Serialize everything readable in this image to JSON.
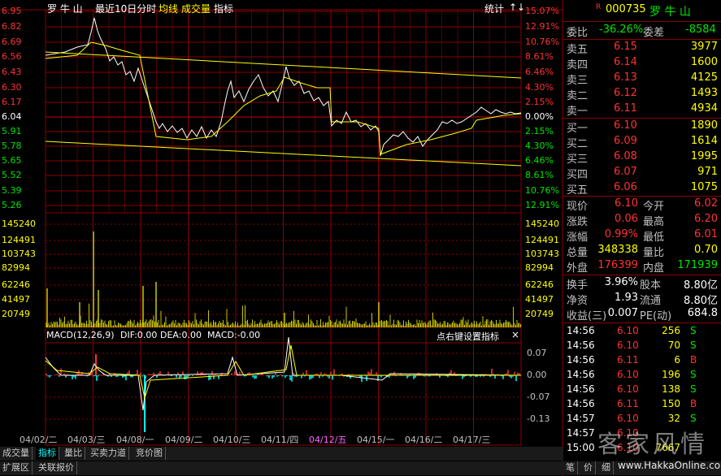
{
  "header": {
    "stock_name": "罗 牛 山",
    "period": "最近10日分时",
    "avg_label": "均线",
    "vol_label": "成交量",
    "indicator_label": "指标",
    "stats_label": "统计",
    "arrow_up": "↑",
    "arrow_down": "↓"
  },
  "price_axis": {
    "left": [
      "6.95",
      "6.82",
      "6.69",
      "6.56",
      "6.43",
      "6.30",
      "6.17",
      "6.04",
      "5.91",
      "5.78",
      "5.65",
      "5.52",
      "5.39",
      "5.26"
    ],
    "right": [
      "15.07%",
      "12.91%",
      "10.76%",
      "8.61%",
      "6.46%",
      "4.30%",
      "2.15%",
      "0.00%",
      "2.15%",
      "4.30%",
      "6.46%",
      "8.61%",
      "10.76%",
      "12.91%"
    ]
  },
  "volume_axis": [
    "145240",
    "124491",
    "103743",
    "82994",
    "62246",
    "41497",
    "20749"
  ],
  "macd": {
    "title": "MACD(12,26,9)",
    "dif": "DIF:0.00",
    "dea": "DEA:0.00",
    "macd": "MACD:-0.00",
    "right_hint": "点右键设置指标",
    "close_glyph": "×",
    "ticks": [
      "0.07",
      "0.00",
      "-0.07",
      "-0.13"
    ]
  },
  "x_axis": [
    "04/02/二",
    "04/03/三",
    "04/08/一",
    "04/09/二",
    "04/10/三",
    "04/11/四",
    "04/12/五",
    "04/15/一",
    "04/16/二",
    "04/17/三"
  ],
  "bottom_tabs": [
    "成交量",
    "指标",
    "量比",
    "买卖力道",
    "竞价图"
  ],
  "bottom_tabs2": [
    "扩展区",
    "关联报价"
  ],
  "quote": {
    "r_badge": "R",
    "code": "000735",
    "name": "罗 牛 山",
    "weibi_label": "委比",
    "weibi": "-36.26%",
    "weicha_label": "委差",
    "weicha": "-8584",
    "asks": [
      {
        "label": "卖五",
        "price": "6.15",
        "vol": "3977"
      },
      {
        "label": "卖四",
        "price": "6.14",
        "vol": "1600"
      },
      {
        "label": "卖三",
        "price": "6.13",
        "vol": "4125"
      },
      {
        "label": "卖二",
        "price": "6.12",
        "vol": "1493"
      },
      {
        "label": "卖一",
        "price": "6.11",
        "vol": "4934"
      }
    ],
    "bids": [
      {
        "label": "买一",
        "price": "6.10",
        "vol": "1890"
      },
      {
        "label": "买二",
        "price": "6.09",
        "vol": "1614"
      },
      {
        "label": "买三",
        "price": "6.08",
        "vol": "1995"
      },
      {
        "label": "买四",
        "price": "6.07",
        "vol": "971"
      },
      {
        "label": "买五",
        "price": "6.06",
        "vol": "1075"
      }
    ],
    "stats1": [
      {
        "l1": "现价",
        "v1": "6.10",
        "l2": "今开",
        "v2": "6.02"
      },
      {
        "l1": "涨跌",
        "v1": "0.06",
        "l2": "最高",
        "v2": "6.20"
      },
      {
        "l1": "涨幅",
        "v1": "0.99%",
        "l2": "最低",
        "v2": "6.01"
      },
      {
        "l1": "总量",
        "v1": "348338",
        "l2": "量比",
        "v2": "0.70"
      },
      {
        "l1": "外盘",
        "v1": "176399",
        "l2": "内盘",
        "v2": "171939"
      }
    ],
    "stats2": [
      {
        "l1": "换手",
        "v1": "3.96%",
        "l2": "股本",
        "v2": "8.80亿"
      },
      {
        "l1": "净资",
        "v1": "1.93",
        "l2": "流通",
        "v2": "8.80亿"
      },
      {
        "l1": "收益(三)",
        "v1": "0.007",
        "l2": "PE(动)",
        "v2": "684.8"
      }
    ],
    "trades": [
      {
        "time": "14:56",
        "price": "6.10",
        "vol": "256",
        "side": "S"
      },
      {
        "time": "14:56",
        "price": "6.10",
        "vol": "70",
        "side": "S"
      },
      {
        "time": "14:56",
        "price": "6.11",
        "vol": "6",
        "side": "B"
      },
      {
        "time": "14:56",
        "price": "6.10",
        "vol": "196",
        "side": "S"
      },
      {
        "time": "14:56",
        "price": "6.10",
        "vol": "138",
        "side": "S"
      },
      {
        "time": "14:56",
        "price": "6.11",
        "vol": "150",
        "side": "B"
      },
      {
        "time": "14:57",
        "price": "6.10",
        "vol": "32",
        "side": "S"
      },
      {
        "time": "14:57",
        "price": "6.10",
        "vol": "",
        "side": ""
      },
      {
        "time": "15:00",
        "price": "6.10",
        "vol": "7667",
        "side": ""
      }
    ],
    "bottom_tabs": [
      "笔",
      "价",
      "细"
    ]
  },
  "watermark": {
    "line1": "客家风情",
    "line2": "www.HakkaOnline.com"
  },
  "colors": {
    "grid": "#8b0000",
    "price_line": "#ffffff",
    "avg_line": "#ffff00",
    "volume": "#c8c800",
    "up": "#ff3232",
    "down": "#00e600",
    "macd_pos": "#ff3232",
    "macd_neg": "#00ffff"
  }
}
